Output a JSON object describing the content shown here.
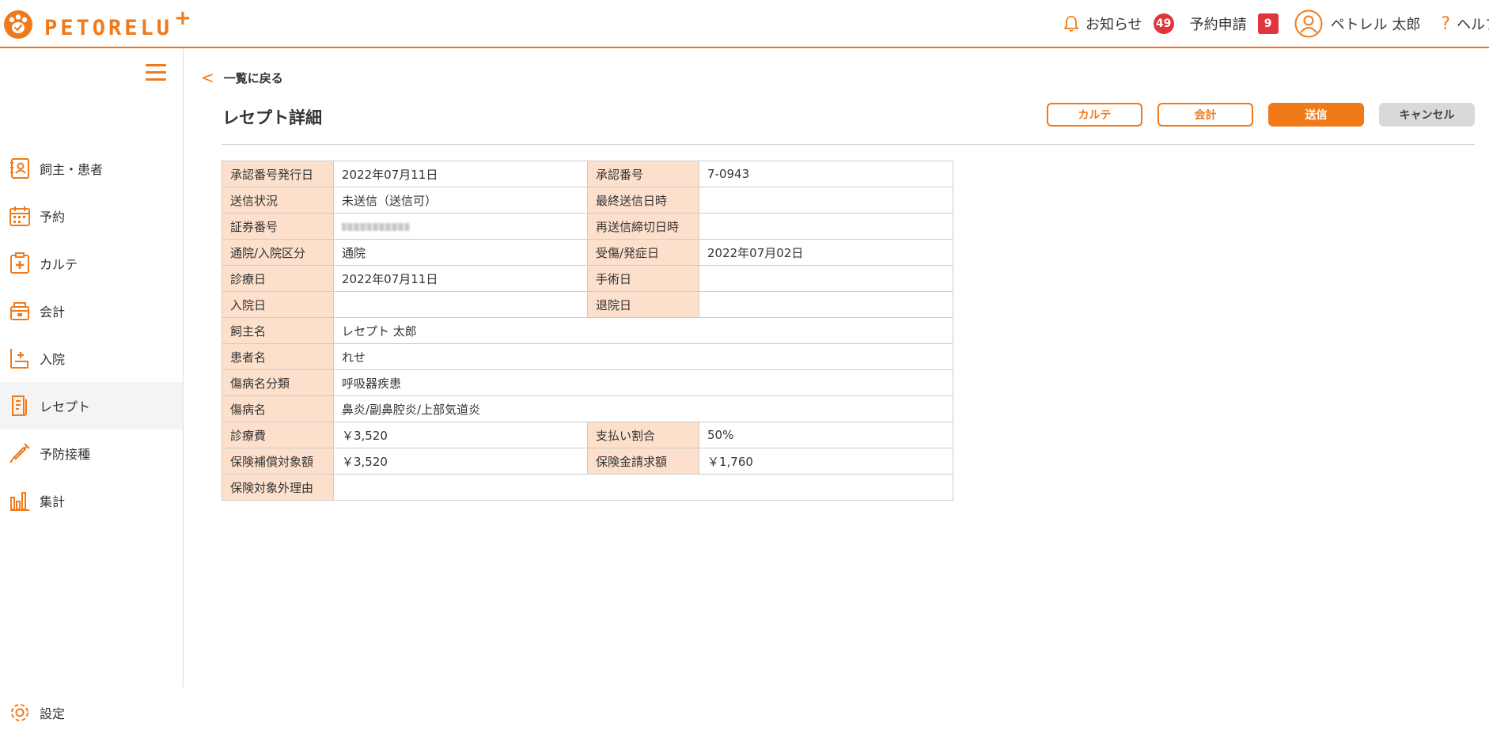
{
  "header": {
    "logo_text": "PETORELU",
    "logo_plus": "+",
    "notifications_label": "お知らせ",
    "notifications_count": "49",
    "booking_label": "予約申請",
    "booking_count": "9",
    "user_name": "ペトレル 太郎",
    "help_label": "ヘルプ"
  },
  "sidebar": {
    "items": [
      {
        "label": "飼主・患者",
        "icon": "owner-patient-icon"
      },
      {
        "label": "予約",
        "icon": "calendar-icon"
      },
      {
        "label": "カルテ",
        "icon": "medical-chart-icon"
      },
      {
        "label": "会計",
        "icon": "register-icon"
      },
      {
        "label": "入院",
        "icon": "hospitalization-icon"
      },
      {
        "label": "レセプト",
        "icon": "receipt-icon"
      },
      {
        "label": "予防接種",
        "icon": "syringe-icon"
      },
      {
        "label": "集計",
        "icon": "bar-chart-icon"
      }
    ],
    "settings_label": "設定",
    "active": "レセプト"
  },
  "main": {
    "back_label": "一覧に戻る",
    "title": "レセプト詳細",
    "buttons": {
      "karte": "カルテ",
      "accounting": "会計",
      "send": "送信",
      "cancel": "キャンセル"
    },
    "colors": {
      "accent": "#f07a1a",
      "label_bg": "#fce0cc",
      "badge": "#e0353d"
    }
  },
  "receipt": {
    "approval_issue_date_label": "承認番号発行日",
    "approval_issue_date": "2022年07月11日",
    "approval_no_label": "承認番号",
    "approval_no": "7-0943",
    "send_status_label": "送信状況",
    "send_status": "未送信（送信可）",
    "last_sent_label": "最終送信日時",
    "last_sent": "",
    "policy_no_label": "証券番号",
    "resend_deadline_label": "再送信締切日時",
    "resend_deadline": "",
    "visit_type_label": "通院/入院区分",
    "visit_type": "通院",
    "onset_date_label": "受傷/発症日",
    "onset_date": "2022年07月02日",
    "treatment_date_label": "診療日",
    "treatment_date": "2022年07月11日",
    "surgery_date_label": "手術日",
    "surgery_date": "",
    "admission_date_label": "入院日",
    "admission_date": "",
    "discharge_date_label": "退院日",
    "discharge_date": "",
    "owner_name_label": "飼主名",
    "owner_name": "レセプト 太郎",
    "patient_name_label": "患者名",
    "patient_name": "れせ",
    "disease_category_label": "傷病名分類",
    "disease_category": "呼吸器疾患",
    "disease_name_label": "傷病名",
    "disease_name": "鼻炎/副鼻腔炎/上部気道炎",
    "treatment_fee_label": "診療費",
    "treatment_fee": "￥3,520",
    "payment_ratio_label": "支払い割合",
    "payment_ratio": "50%",
    "covered_amount_label": "保険補償対象額",
    "covered_amount": "￥3,520",
    "claim_amount_label": "保険金請求額",
    "claim_amount": "￥1,760",
    "exclusion_reason_label": "保険対象外理由",
    "exclusion_reason": ""
  }
}
